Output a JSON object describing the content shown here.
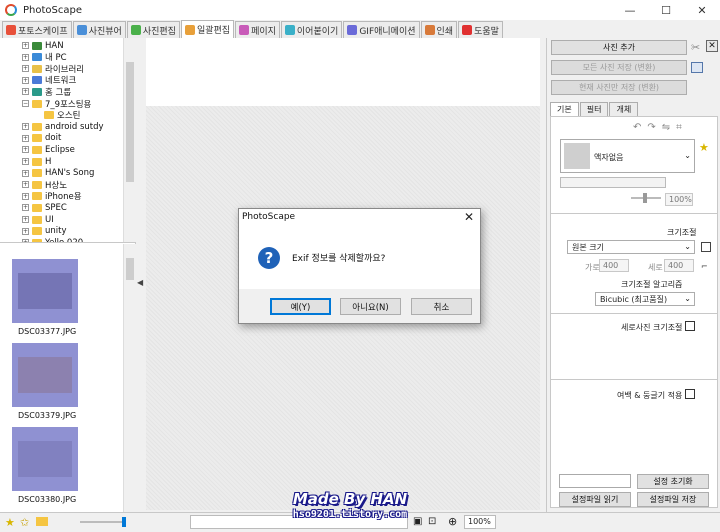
{
  "window": {
    "title": "PhotoScape",
    "min": "—",
    "max": "☐",
    "close": "✕"
  },
  "tabs": [
    {
      "label": "포토스케이프",
      "color": "#e8503a"
    },
    {
      "label": "사진뷰어",
      "color": "#4a8fd8"
    },
    {
      "label": "사진편집",
      "color": "#4ab04a"
    },
    {
      "label": "일괄편집",
      "color": "#e8a03a"
    },
    {
      "label": "페이지",
      "color": "#c85ab8"
    },
    {
      "label": "이어붙이기",
      "color": "#3ab0c8"
    },
    {
      "label": "GIF애니메이션",
      "color": "#6a6ad8"
    },
    {
      "label": "인쇄",
      "color": "#d87a3a"
    },
    {
      "label": "도움말",
      "color": "#e03030"
    }
  ],
  "tree": [
    {
      "label": "HAN",
      "ico": "user"
    },
    {
      "label": "내 PC",
      "ico": "pc"
    },
    {
      "label": "라이브러리",
      "ico": "lib"
    },
    {
      "label": "네트워크",
      "ico": "net"
    },
    {
      "label": "홈 그룹",
      "ico": "home"
    },
    {
      "label": "7_9포스팅용",
      "ico": "folder"
    },
    {
      "label": "오스틴",
      "ico": "folder"
    },
    {
      "label": "android sutdy",
      "ico": "folder"
    },
    {
      "label": "doit",
      "ico": "folder"
    },
    {
      "label": "Eclipse",
      "ico": "folder"
    },
    {
      "label": "H",
      "ico": "folder"
    },
    {
      "label": "HAN's Song",
      "ico": "folder"
    },
    {
      "label": "H상노",
      "ico": "folder"
    },
    {
      "label": "iPhone용",
      "ico": "folder"
    },
    {
      "label": "SPEC",
      "ico": "folder"
    },
    {
      "label": "UI",
      "ico": "folder"
    },
    {
      "label": "unity",
      "ico": "folder"
    },
    {
      "label": "Yello 020",
      "ico": "folder"
    }
  ],
  "thumbnails": [
    {
      "name": "DSC03377.JPG"
    },
    {
      "name": "DSC03379.JPG"
    },
    {
      "name": "DSC03380.JPG"
    }
  ],
  "right": {
    "add_photo": "사진 추가",
    "save_all": "모든 사진 저장 (변환)",
    "save_current": "현재 사진만 저장 (변환)",
    "tabs": [
      "기본",
      "필터",
      "개체"
    ],
    "frame": "액자없음",
    "frame_pct": "100%",
    "resize_label": "크기조절",
    "resize_value": "원본 크기",
    "width_label": "가로",
    "width_value": "400",
    "height_label": "세로",
    "height_value": "400",
    "algo_label": "크기조절 알고리즘",
    "algo_value": "Bicubic (최고품질)",
    "portrait_label": "세로사진 크기조절",
    "margin_label": "여백 & 둥글기 적용",
    "reset": "설정 초기화",
    "load_cfg": "설정파일 읽기",
    "save_cfg": "설정파일 저장"
  },
  "dialog": {
    "title": "PhotoScape",
    "close": "✕",
    "icon": "?",
    "message": "Exif 정보를 삭제할까요?",
    "yes": "예(Y)",
    "no": "아니요(N)",
    "cancel": "취소"
  },
  "status": {
    "zoom": "100%"
  },
  "watermark": {
    "line1": "Made By HAN",
    "line2": "hso9201.tistory.com"
  }
}
